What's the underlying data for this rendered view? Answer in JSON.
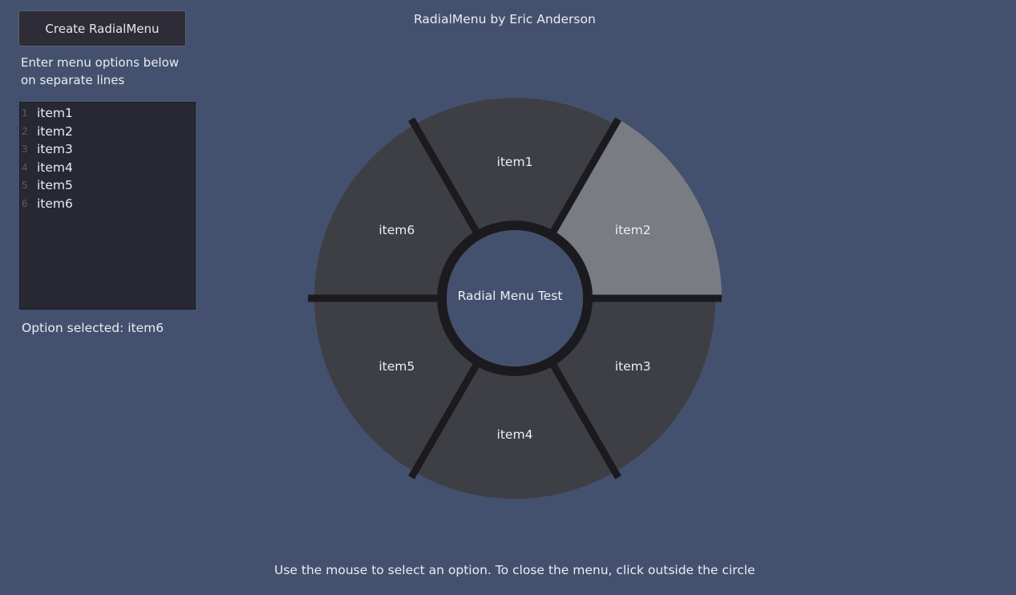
{
  "app": {
    "title": "RadialMenu by Eric Anderson",
    "footer": "Use the mouse to select an option. To close the menu, click outside the circle"
  },
  "sidebar": {
    "create_button_label": "Create RadialMenu",
    "instructions_line1": "Enter menu options below",
    "instructions_line2": "on separate lines",
    "editor_lines": [
      {
        "num": "1",
        "text": "item1"
      },
      {
        "num": "2",
        "text": "item2"
      },
      {
        "num": "3",
        "text": "item3"
      },
      {
        "num": "4",
        "text": "item4"
      },
      {
        "num": "5",
        "text": "item5"
      },
      {
        "num": "6",
        "text": "item6"
      }
    ],
    "status_text": "Option selected: item6"
  },
  "radial_menu": {
    "center_label": "Radial Menu Test",
    "items": [
      "item1",
      "item2",
      "item3",
      "item4",
      "item5",
      "item6"
    ],
    "highlighted_item": "item2",
    "colors": {
      "segment": "#3e3e45",
      "segment_highlight": "#7a7c84",
      "divider": "#1b1b1f",
      "center": "#44516e"
    }
  }
}
